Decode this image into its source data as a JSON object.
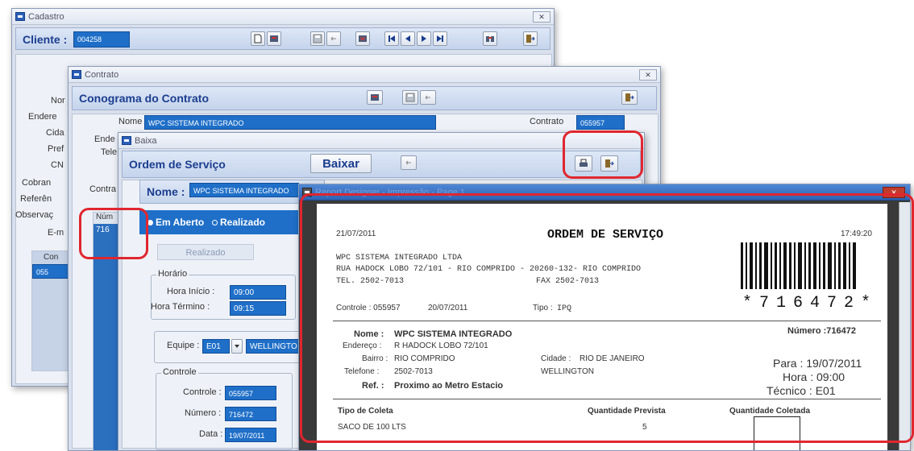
{
  "cadastro": {
    "title": "Cadastro",
    "client_label": "Cliente :",
    "client_value": "004258",
    "side_labels": [
      "Nor",
      "Endere",
      "Cida",
      "Pref",
      "CN",
      "Cobran",
      "Referên",
      "Observaç",
      "E-m"
    ],
    "tab_con": "Con",
    "row_value": "055"
  },
  "contrato": {
    "title": "Contrato",
    "header": "Conograma do Contrato",
    "nome_label": "Nome",
    "nome_value": "WPC SISTEMA INTEGRADO",
    "contrato_label": "Contrato",
    "contrato_value": "055957",
    "ende_label": "Ende",
    "tele_label": "Tele",
    "tab_contra": "Contra",
    "grid_header": "Núm",
    "grid_value": "716"
  },
  "baixa": {
    "title": "Baixa",
    "header": "Ordem de Serviço",
    "baixar_label": "Baixar",
    "nome_label": "Nome :",
    "nome_value": "WPC SISTEMA INTEGRADO",
    "status_em_aberto": "Em Aberto",
    "status_realizado": "Realizado",
    "realizado_box": "Realizado",
    "horario_legend": "Horário",
    "hora_inicio_label": "Hora Início :",
    "hora_inicio_value": "09:00",
    "hora_termino_label": "Hora Término :",
    "hora_termino_value": "09:15",
    "equipe_label": "Equipe :",
    "equipe_value": "E01",
    "equipe_name": "WELLINGTO",
    "controle_legend": "Controle",
    "controle_label": "Controle :",
    "controle_value": "055957",
    "numero_label": "Número :",
    "numero_value": "716472",
    "data_label": "Data :",
    "data_value": "19/07/2011"
  },
  "report": {
    "window_title": "Report Designer - Impressão - Page 1",
    "date": "21/07/2011",
    "title": "ORDEM DE SERVIÇO",
    "time": "17:49:20",
    "company_line1": "WPC SISTEMA INTEGRADO LTDA",
    "company_line2": "RUA HADOCK LOBO 72/101 - RIO COMPRIDO - 20260-132- RIO COMPRIDO",
    "tel": "TEL. 2502-7013",
    "fax": "FAX 2502-7013",
    "barcode_text": "*716472*",
    "controle": "Controle :  055957",
    "controle_date": "20/07/2011",
    "tipo_label": "Tipo :",
    "tipo_value": "IPQ",
    "nome_label": "Nome :",
    "nome_value": "WPC SISTEMA INTEGRADO",
    "numero": "Número :716472",
    "endereco_label": "Endereço :",
    "endereco_value": "R HADOCK LOBO 72/101",
    "bairro_label": "Bairro :",
    "bairro_value": "RIO COMPRIDO",
    "cidade_label": "Cidade :",
    "cidade_value": "RIO DE JANEIRO",
    "telefone_label": "Telefone :",
    "telefone_value": "2502-7013",
    "tecnico_name": "WELLINGTON",
    "ref_label": "Ref. :",
    "ref_value": "Proximo ao Metro Estacio",
    "para": "Para : 19/07/2011",
    "hora": "Hora : 09:00",
    "tecnico": "Técnico : E01",
    "col_tipo": "Tipo de Coleta",
    "col_prevista": "Quantidade Prevista",
    "col_coletada": "Quantidade Coletada",
    "row_tipo": "SACO DE 100 LTS",
    "row_prevista": "5"
  },
  "colors": {
    "accent_blue": "#1f6fc8",
    "highlight_red": "#e0262f",
    "header_text": "#1a3d8f"
  }
}
